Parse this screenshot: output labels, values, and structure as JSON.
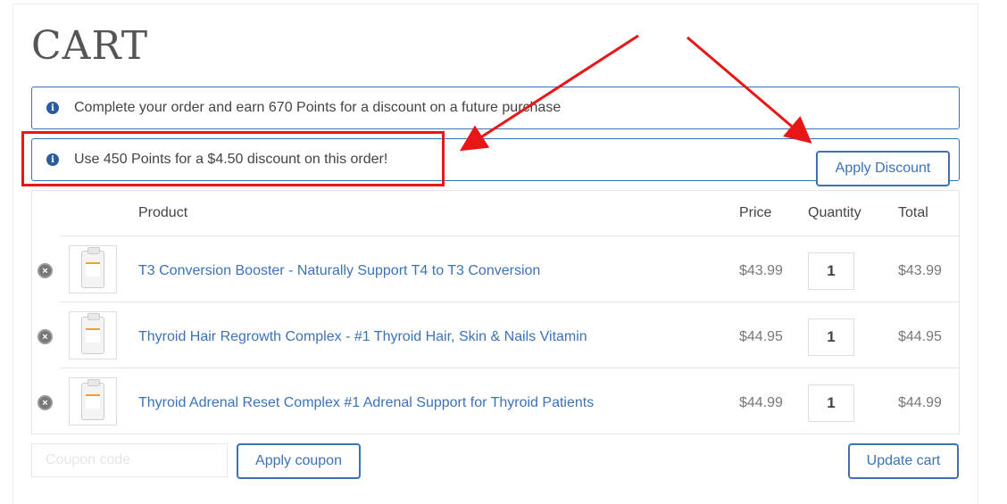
{
  "page": {
    "title": "CART"
  },
  "notices": [
    {
      "text": "Complete your order and earn 670 Points for a discount on a future purchase",
      "icon": "info-icon"
    },
    {
      "text": "Use 450 Points for a $4.50 discount on this order!",
      "icon": "info-icon"
    }
  ],
  "apply_discount_label": "Apply Discount",
  "table": {
    "headers": {
      "product": "Product",
      "price": "Price",
      "quantity": "Quantity",
      "total": "Total"
    },
    "rows": [
      {
        "name": "T3 Conversion Booster - Naturally Support T4 to T3 Conversion",
        "price": "$43.99",
        "quantity": "1",
        "total": "$43.99"
      },
      {
        "name": "Thyroid Hair Regrowth Complex - #1 Thyroid Hair, Skin & Nails Vitamin",
        "price": "$44.95",
        "quantity": "1",
        "total": "$44.95"
      },
      {
        "name": "Thyroid Adrenal Reset Complex #1 Adrenal Support for Thyroid Patients",
        "price": "$44.99",
        "quantity": "1",
        "total": "$44.99"
      }
    ]
  },
  "coupon": {
    "placeholder": "Coupon code",
    "value": "",
    "apply_label": "Apply coupon"
  },
  "update_cart_label": "Update cart",
  "colors": {
    "accent": "#3d72b5",
    "annotation": "#e81616"
  }
}
